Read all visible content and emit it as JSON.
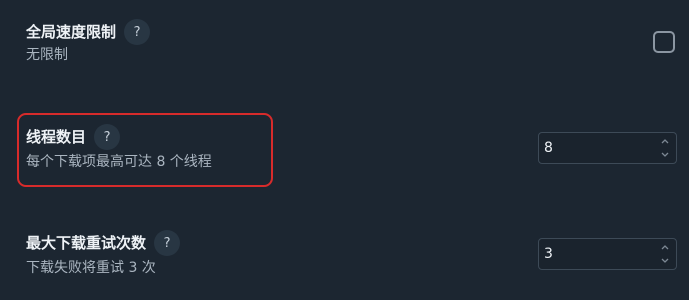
{
  "settings": {
    "global_speed_limit": {
      "title": "全局速度限制",
      "help_glyph": "?",
      "description": "无限制",
      "checked": false
    },
    "thread_count": {
      "title": "线程数目",
      "help_glyph": "?",
      "description": "每个下载项最高可达 8 个线程",
      "value": "8",
      "highlighted": true,
      "highlight_color": "#d72b2b"
    },
    "max_retries": {
      "title": "最大下载重试次数",
      "help_glyph": "?",
      "description": "下载失败将重试 3 次",
      "value": "3"
    }
  },
  "icons": {
    "help": "question-mark-icon",
    "spin_up": "chevron-up-icon",
    "spin_down": "chevron-down-icon"
  },
  "colors": {
    "background": "#1c2631",
    "title_text": "#eef2f6",
    "description_text": "#aab5c0",
    "help_bubble": "#283643",
    "input_border": "#3d4a57",
    "checkbox_border": "#8b96a2"
  }
}
